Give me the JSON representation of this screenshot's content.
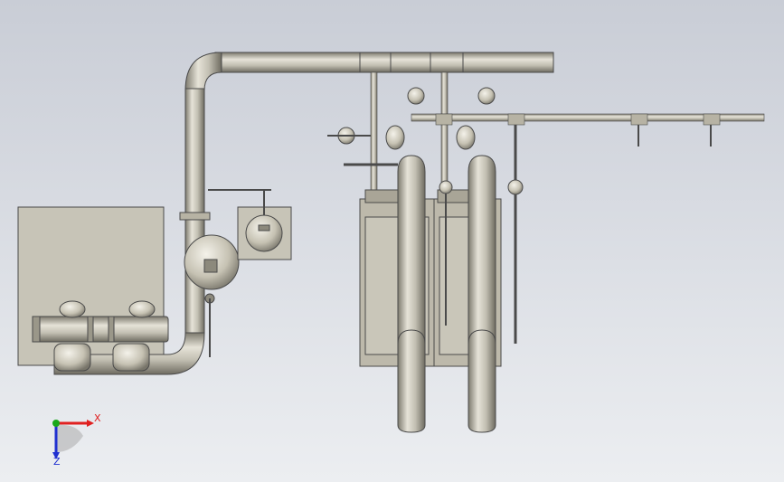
{
  "colors": {
    "background_top": "#c9cdd6",
    "background_bottom": "#eceef1",
    "pipe": "#b7b3a4",
    "pipe_light": "#e6e3d8",
    "pipe_dark": "#7d7a6e",
    "tank_panel": "#c7c4b7",
    "outline": "#4a4a4a",
    "axis_x": "#e02020",
    "axis_y": "#1aa81a",
    "axis_z": "#2030d0"
  },
  "triad": {
    "x_label": "X",
    "z_label": "Z"
  },
  "icons": [
    "coordinate-triad-icon"
  ]
}
